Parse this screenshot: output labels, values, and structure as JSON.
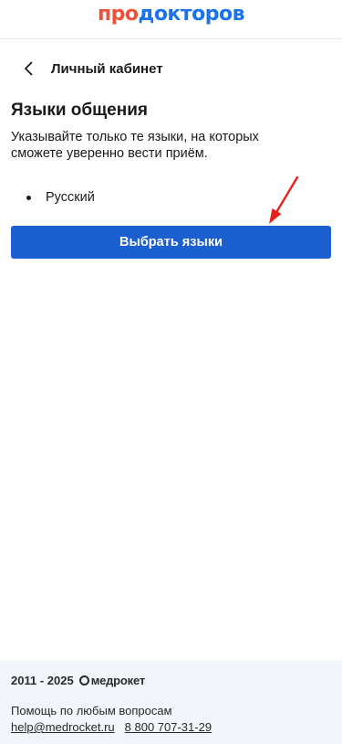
{
  "header": {
    "logo_part1": "про",
    "logo_part2": "докторов",
    "logo_colors": {
      "part1": "#f0503a",
      "part2": "#1a73e8"
    }
  },
  "nav": {
    "back_label": "Личный кабинет",
    "back_icon": "chevron-left-icon"
  },
  "section": {
    "title": "Языки общения",
    "description": "Указывайте только те языки, на которых сможете уверенно вести приём.",
    "languages": [
      "Русский"
    ],
    "button_label": "Выбрать языки",
    "button_color": "#1b5fd1"
  },
  "annotation": {
    "arrow_color": "#e8221e",
    "arrow_icon": "red-arrow-icon"
  },
  "footer": {
    "years": "2011 - 2025",
    "brand": "медрокет",
    "help_text": "Помощь по любым вопросам",
    "email": "help@medrocket.ru",
    "phone": "8 800 707-31-29",
    "background": "#f2f5f9"
  }
}
